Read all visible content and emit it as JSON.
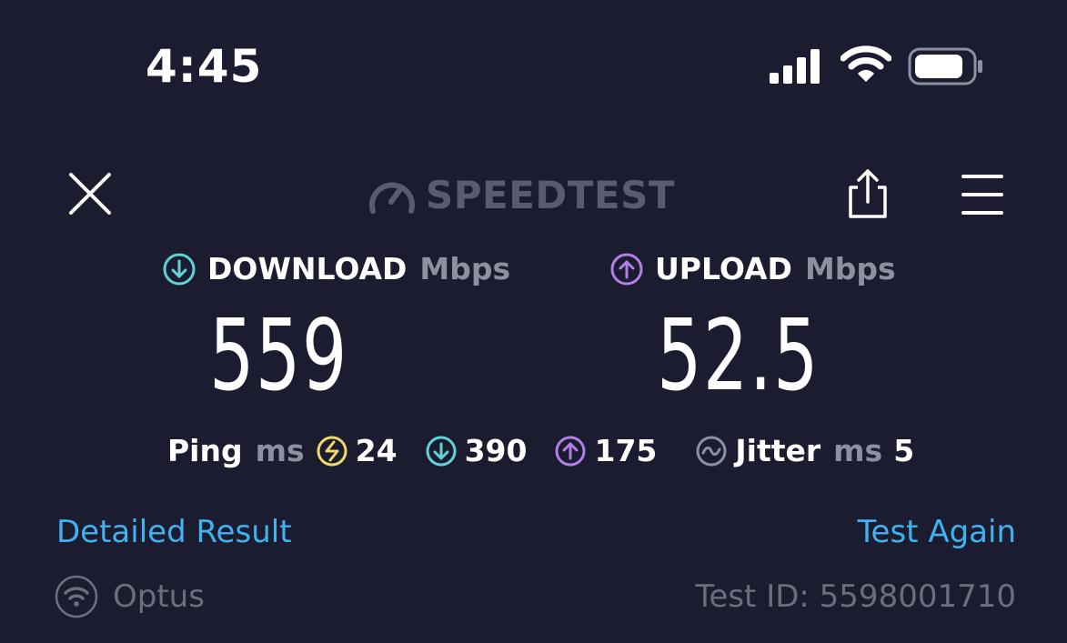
{
  "status_bar": {
    "time": "4:45"
  },
  "toolbar": {
    "logo_text": "SPEEDTEST",
    "close_icon": "close-icon",
    "share_icon": "share-icon",
    "menu_icon": "menu-icon"
  },
  "download": {
    "label": "DOWNLOAD",
    "unit": "Mbps",
    "value": "559",
    "color": "#5fd3d8"
  },
  "upload": {
    "label": "UPLOAD",
    "unit": "Mbps",
    "value": "52.5",
    "color": "#b27fe8"
  },
  "ping": {
    "label": "Ping",
    "unit": "ms",
    "idle": "24",
    "download": "390",
    "upload": "175",
    "idle_color": "#f0d86a"
  },
  "jitter": {
    "label": "Jitter",
    "unit": "ms",
    "value": "5"
  },
  "links": {
    "detailed_result": "Detailed Result",
    "test_again": "Test Again",
    "color": "#3fb2ef"
  },
  "footer": {
    "provider": "Optus",
    "test_id": "Test ID: 5598001710"
  }
}
